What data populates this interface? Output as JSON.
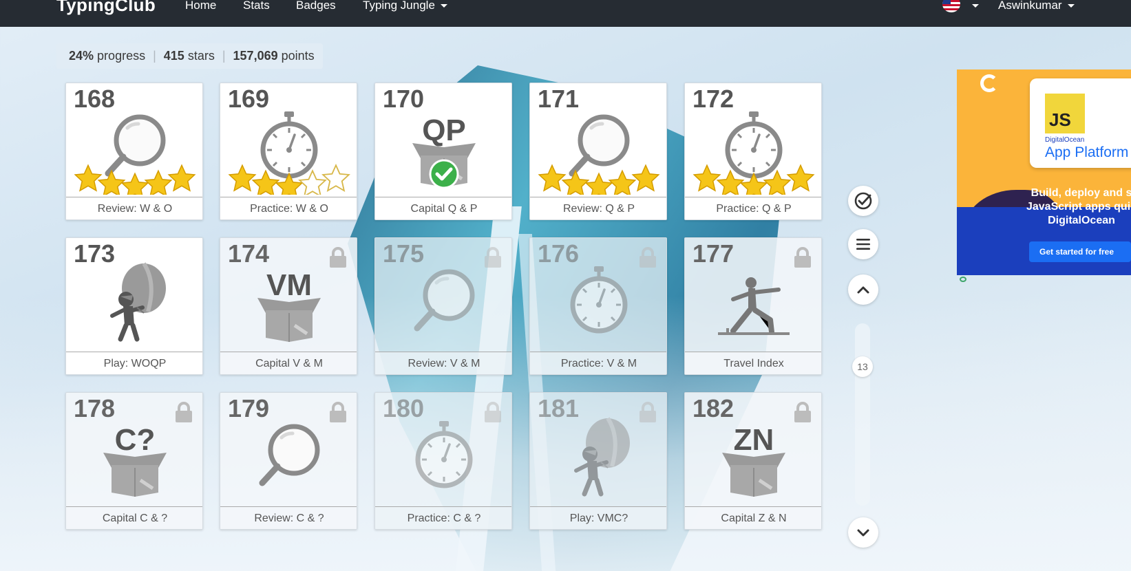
{
  "nav": {
    "brand": "TypingClub",
    "items": [
      "Home",
      "Stats",
      "Badges",
      "Typing Jungle"
    ],
    "user": "Aswinkumar"
  },
  "summary": {
    "progress_value": "24%",
    "progress_label": "progress",
    "stars_value": "415",
    "stars_label": "stars",
    "points_value": "157,069",
    "points_label": "points"
  },
  "lessons": [
    {
      "num": "168",
      "label": "Review: W & O",
      "icon": "magnifier-icon",
      "stars": 5,
      "locked": false
    },
    {
      "num": "169",
      "label": "Practice: W & O",
      "icon": "stopwatch-icon",
      "stars": 3,
      "locked": false
    },
    {
      "num": "170",
      "label": "Capital Q & P",
      "icon": "box-icon",
      "letters": "QP",
      "done": true,
      "locked": false
    },
    {
      "num": "171",
      "label": "Review: Q & P",
      "icon": "magnifier-icon",
      "stars": 5,
      "locked": false
    },
    {
      "num": "172",
      "label": "Practice: Q & P",
      "icon": "stopwatch-icon",
      "stars": 5,
      "locked": false
    },
    {
      "num": "173",
      "label": "Play: WOQP",
      "icon": "balloon-icon",
      "locked": false
    },
    {
      "num": "174",
      "label": "Capital V & M",
      "icon": "box-icon",
      "letters": "VM",
      "locked": true
    },
    {
      "num": "175",
      "label": "Review: V & M",
      "icon": "magnifier-icon",
      "locked": true
    },
    {
      "num": "176",
      "label": "Practice: V & M",
      "icon": "stopwatch-icon",
      "locked": true
    },
    {
      "num": "177",
      "label": "Travel Index",
      "icon": "lunge-figure-icon",
      "locked": true
    },
    {
      "num": "178",
      "label": "Capital C & ?",
      "icon": "box-icon",
      "letters": "C?",
      "locked": true
    },
    {
      "num": "179",
      "label": "Review: C & ?",
      "icon": "magnifier-icon",
      "locked": true
    },
    {
      "num": "180",
      "label": "Practice: C & ?",
      "icon": "stopwatch-icon",
      "locked": true
    },
    {
      "num": "181",
      "label": "Play: VMC?",
      "icon": "balloon-icon",
      "locked": true
    },
    {
      "num": "182",
      "label": "Capital Z & N",
      "icon": "box-icon",
      "letters": "ZN",
      "locked": true
    }
  ],
  "side_controls": {
    "page_indicator": "13"
  },
  "ad": {
    "badge": "JS",
    "brand": "DigitalOcean",
    "product": "App Platform",
    "copy_line1": "Build, deploy and s",
    "copy_line2": "JavaScript apps quic",
    "copy_line3": "DigitalOcean",
    "cta": "Get started for free"
  },
  "colors": {
    "topbar": "#262c33",
    "star": "#f5c518",
    "done": "#3cb04a",
    "icon_gray": "#8a8a8a"
  }
}
